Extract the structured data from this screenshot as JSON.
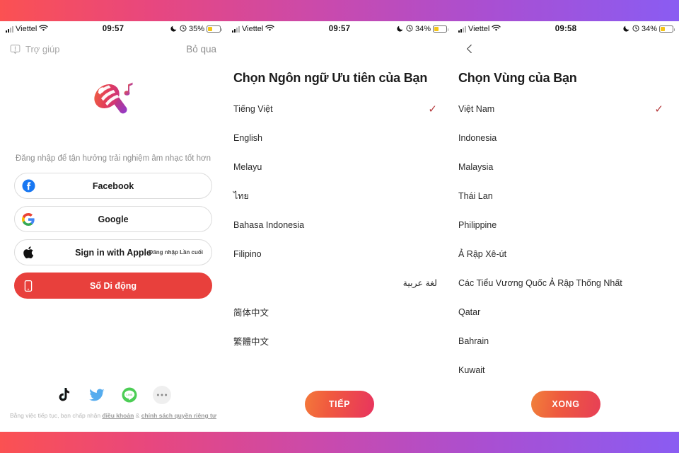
{
  "theme": {
    "gradient_start": "#fb5152",
    "gradient_mid": "#c94aad",
    "gradient_end": "#8a5cf2",
    "accent_red": "#e8403c",
    "check_color": "#b5393c"
  },
  "panel_login": {
    "status_bar": {
      "carrier": "Viettel",
      "time": "09:57",
      "battery_percent": "35%",
      "signal_icon": "signal-bars-icon",
      "wifi_icon": "wifi-icon",
      "moon_icon": "do-not-disturb-moon-icon",
      "alarm_icon": "alarm-icon",
      "battery_icon": "battery-icon"
    },
    "nav": {
      "help_label": "Trợ giúp",
      "help_icon": "help-bubble-icon",
      "skip_label": "Bỏ qua"
    },
    "logo_icon": "starmaker-microphone-logo",
    "tagline": "Đăng nhập để tận hưởng trải nghiệm âm nhạc tốt hơn",
    "buttons": [
      {
        "label": "Facebook",
        "icon": "facebook-icon",
        "badge": ""
      },
      {
        "label": "Google",
        "icon": "google-icon",
        "badge": ""
      },
      {
        "label": "Sign in with Apple",
        "icon": "apple-icon",
        "badge": "Đăng nhập Lần cuối"
      },
      {
        "label": "Số Di động",
        "icon": "mobile-phone-icon",
        "badge": ""
      }
    ],
    "social": [
      {
        "icon": "tiktok-icon"
      },
      {
        "icon": "twitter-icon"
      },
      {
        "icon": "line-icon"
      },
      {
        "icon": "more-options-icon",
        "glyph": "•••"
      }
    ],
    "legal": {
      "prefix": "Bằng việc tiếp tục, bạn chấp nhận ",
      "terms": "điều khoản",
      "separator": " & ",
      "privacy": "chính sách quyền riêng tư"
    }
  },
  "panel_language": {
    "status_bar": {
      "carrier": "Viettel",
      "time": "09:57",
      "battery_percent": "34%"
    },
    "title": "Chọn Ngôn ngữ Ưu tiên của Bạn",
    "options": [
      {
        "label": "Tiếng Việt",
        "selected": true
      },
      {
        "label": "English",
        "selected": false
      },
      {
        "label": "Melayu",
        "selected": false
      },
      {
        "label": "ไทย",
        "selected": false
      },
      {
        "label": "Bahasa Indonesia",
        "selected": false
      },
      {
        "label": "Filipino",
        "selected": false
      },
      {
        "label": "لغة عربية",
        "selected": false
      },
      {
        "label": "简体中文",
        "selected": false
      },
      {
        "label": "繁體中文",
        "selected": false
      }
    ],
    "check_glyph": "✓",
    "cta_label": "TIẾP"
  },
  "panel_region": {
    "status_bar": {
      "carrier": "Viettel",
      "time": "09:58",
      "battery_percent": "34%"
    },
    "nav": {
      "back_icon": "back-chevron-icon"
    },
    "title": "Chọn Vùng của Bạn",
    "options": [
      {
        "label": "Việt Nam",
        "selected": true
      },
      {
        "label": "Indonesia",
        "selected": false
      },
      {
        "label": "Malaysia",
        "selected": false
      },
      {
        "label": "Thái Lan",
        "selected": false
      },
      {
        "label": "Philippine",
        "selected": false
      },
      {
        "label": "Ả Rập Xê-út",
        "selected": false
      },
      {
        "label": "Các Tiểu Vương Quốc Ả Rập Thống Nhất",
        "selected": false
      },
      {
        "label": "Qatar",
        "selected": false
      },
      {
        "label": "Bahrain",
        "selected": false
      },
      {
        "label": "Kuwait",
        "selected": false
      }
    ],
    "check_glyph": "✓",
    "cta_label": "XONG"
  }
}
